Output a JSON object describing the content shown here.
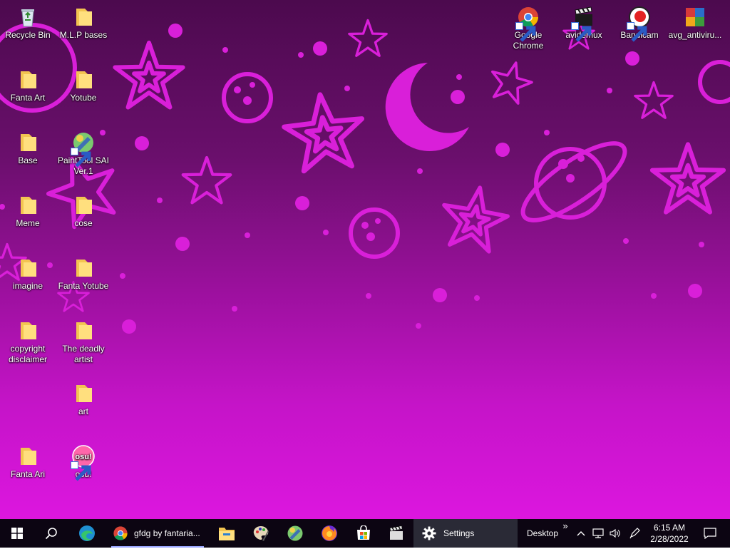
{
  "desktop_icons": [
    {
      "label": "Recycle Bin",
      "icon": "recycle-bin-icon"
    },
    {
      "label": "M.L.P bases",
      "icon": "folder-icon"
    },
    {
      "label": "Fanta Art",
      "icon": "folder-icon"
    },
    {
      "label": "Yotube",
      "icon": "folder-icon"
    },
    {
      "label": "Base",
      "icon": "folder-icon"
    },
    {
      "label": "PaintTool SAI Ver.1",
      "icon": "painttool-sai-icon"
    },
    {
      "label": "Meme",
      "icon": "folder-icon"
    },
    {
      "label": "cose",
      "icon": "folder-icon"
    },
    {
      "label": "imagine",
      "icon": "folder-icon"
    },
    {
      "label": "Fanta Yotube",
      "icon": "folder-icon"
    },
    {
      "label": "copyright disclaimer",
      "icon": "folder-icon"
    },
    {
      "label": "The deadly artist",
      "icon": "folder-icon"
    },
    {
      "label": "art",
      "icon": "folder-icon"
    },
    {
      "label": "Fanta Ari",
      "icon": "folder-icon"
    },
    {
      "label": "osu!",
      "icon": "osu-icon"
    },
    {
      "label": "Google Chrome",
      "icon": "chrome-icon"
    },
    {
      "label": "avidemux",
      "icon": "avidemux-icon"
    },
    {
      "label": "Bandicam",
      "icon": "bandicam-icon"
    },
    {
      "label": "avg_antiviru...",
      "icon": "avg-antivirus-icon"
    }
  ],
  "osu_badge": "osu!",
  "taskbar": {
    "start_icon": "windows-start-icon",
    "search_icon": "search-icon",
    "edge_icon": "edge-icon",
    "chrome_window_title": "gfdg by fantaria...",
    "file_explorer_icon": "file-explorer-icon",
    "paint_icon": "paint-icon",
    "sai_icon": "painttool-sai-icon",
    "firefox_icon": "firefox-icon",
    "store_icon": "microsoft-store-icon",
    "avidemux_icon": "avidemux-icon",
    "settings_label": "Settings",
    "desktop_toolbar_label": "Desktop",
    "toolbar_overflow": "»",
    "time": "6:15 AM",
    "date": "2/28/2022"
  },
  "colors": {
    "wallpaper_top": "#4c0a4e",
    "wallpaper_bottom": "#dc16df",
    "wallpaper_shapes": "#d91fd9",
    "taskbar": "#0c0512",
    "settings_active": "#2a2a36",
    "chrome_underline": "#9aa6ff"
  }
}
